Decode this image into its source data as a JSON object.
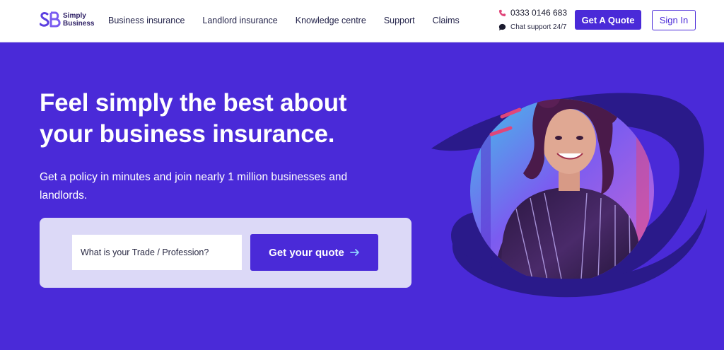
{
  "header": {
    "logo": {
      "mark": "SB",
      "line1": "Simply",
      "line2": "Business"
    },
    "nav": [
      {
        "label": "Business insurance"
      },
      {
        "label": "Landlord insurance"
      },
      {
        "label": "Knowledge centre"
      },
      {
        "label": "Support"
      },
      {
        "label": "Claims"
      }
    ],
    "contact": {
      "phone": "0333 0146 683",
      "chat": "Chat support 24/7"
    },
    "quote_button": "Get A Quote",
    "signin_button": "Sign In"
  },
  "hero": {
    "title_line1": "Feel simply the best about",
    "title_line2": "your business insurance.",
    "subtitle": "Get a policy in minutes and join nearly 1 million businesses and landlords.",
    "trade_input": {
      "value": "",
      "placeholder": "What is your Trade / Profession?"
    },
    "quote_button": "Get your quote",
    "image_icon": "performer-photo"
  },
  "colors": {
    "brand_purple": "#4a2ad8",
    "panel": "#dcd9f7",
    "dark_swirl": "#2a1a8a",
    "accent_pink": "#e0467a"
  }
}
